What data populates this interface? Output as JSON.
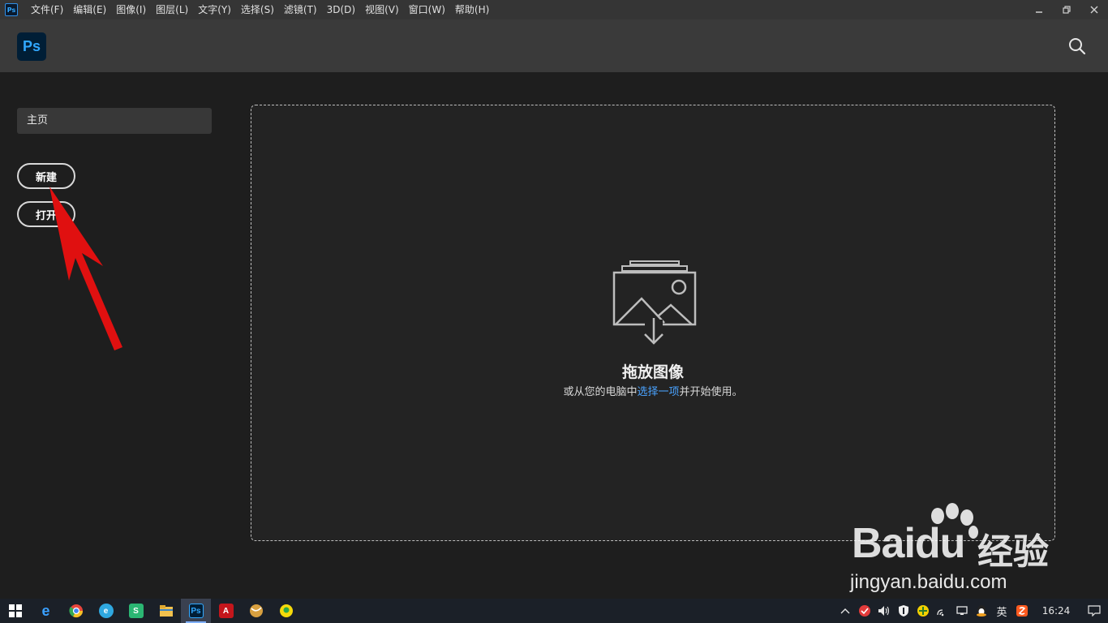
{
  "menubar": {
    "app_icon": "Ps",
    "items": [
      "文件(F)",
      "编辑(E)",
      "图像(I)",
      "图层(L)",
      "文字(Y)",
      "选择(S)",
      "滤镜(T)",
      "3D(D)",
      "视图(V)",
      "窗口(W)",
      "帮助(H)"
    ],
    "window_controls": [
      "minimize-icon",
      "restore-icon",
      "close-icon"
    ]
  },
  "header": {
    "logo": "Ps",
    "search_icon": "search-icon"
  },
  "sidebar": {
    "home_label": "主页",
    "new_label": "新建",
    "open_label": "打开"
  },
  "dropzone": {
    "icon": "image-drop-icon",
    "title": "拖放图像",
    "subtitle_before": "或从您的电脑中",
    "subtitle_link": "选择一项",
    "subtitle_after": "并开始使用。"
  },
  "watermark": {
    "brand": "Bai",
    "brand_du": "du",
    "brand_cn": "经验",
    "url": "jingyan.baidu.com"
  },
  "taskbar": {
    "apps": [
      {
        "name": "ie-icon",
        "glyph": "e",
        "color": "#1e90ff"
      },
      {
        "name": "chrome-icon",
        "glyph": "",
        "color": "#e8453c"
      },
      {
        "name": "edge-icon",
        "glyph": "e",
        "color": "#2fa8e0"
      },
      {
        "name": "wps-icon",
        "glyph": "S",
        "color": "#2bb673"
      },
      {
        "name": "folder-icon",
        "glyph": "",
        "color": "#f2c14e"
      },
      {
        "name": "photoshop-icon",
        "glyph": "Ps",
        "color": "#001e36"
      },
      {
        "name": "acrobat-icon",
        "glyph": "A",
        "color": "#c4161c"
      },
      {
        "name": "app-ball-icon",
        "glyph": "",
        "color": "#d8a040"
      },
      {
        "name": "app-yellow-icon",
        "glyph": "",
        "color": "#f5d90a"
      }
    ],
    "tray": {
      "lang": "英",
      "time": "16:24"
    }
  }
}
